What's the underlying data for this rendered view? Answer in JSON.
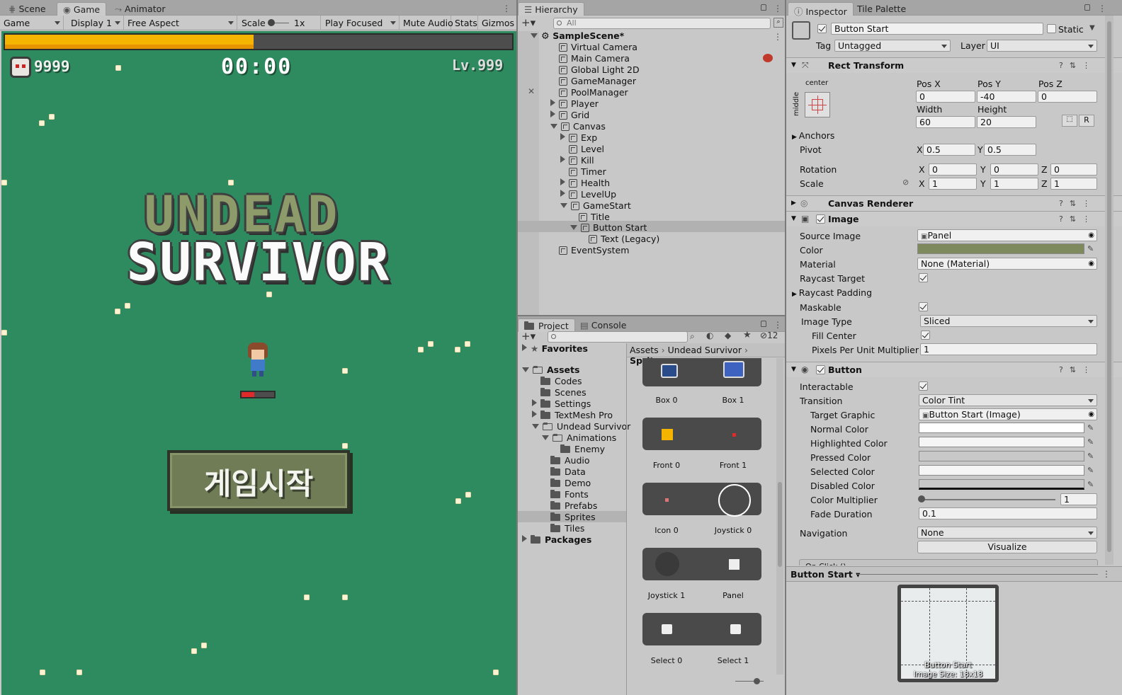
{
  "game_panel": {
    "tabs": [
      "Scene",
      "Game",
      "Animator"
    ],
    "toolbar": {
      "display_mode": "Game",
      "display": "Display 1",
      "aspect": "Free Aspect",
      "scale_label": "Scale",
      "scale_value": "1x",
      "play_mode": "Play Focused",
      "mute": "Mute Audio",
      "stats": "Stats",
      "gizmos": "Gizmos"
    },
    "hud": {
      "kills": "9999",
      "timer": "00:00",
      "level": "Lv.999",
      "exp_fill": 0.49
    },
    "title_line1": "UNDEAD",
    "title_line2": "SURVIVOR",
    "start_button": "게임시작",
    "colors": {
      "grass": "#2e8a5f",
      "exp_bar": "#f5b400",
      "button": "#6f7c55"
    }
  },
  "hierarchy": {
    "tab": "Hierarchy",
    "search_placeholder": "All",
    "scene": "SampleScene*",
    "items": [
      {
        "label": "Virtual Camera"
      },
      {
        "label": "Main Camera"
      },
      {
        "label": "Global Light 2D"
      },
      {
        "label": "GameManager"
      },
      {
        "label": "PoolManager"
      },
      {
        "label": "Player"
      },
      {
        "label": "Grid"
      },
      {
        "label": "Canvas"
      },
      {
        "label": "Exp"
      },
      {
        "label": "Level"
      },
      {
        "label": "Kill"
      },
      {
        "label": "Timer"
      },
      {
        "label": "Health"
      },
      {
        "label": "LevelUp"
      },
      {
        "label": "GameStart"
      },
      {
        "label": "Title"
      },
      {
        "label": "Button Start"
      },
      {
        "label": "Text (Legacy)"
      },
      {
        "label": "EventSystem"
      }
    ]
  },
  "project": {
    "tabs": [
      "Project",
      "Console"
    ],
    "count": "12",
    "breadcrumb": [
      "Assets",
      "Undead Survivor",
      "Sprites"
    ],
    "tree": {
      "favorites": "Favorites",
      "assets": "Assets",
      "codes": "Codes",
      "scenes": "Scenes",
      "settings": "Settings",
      "textmesh": "TextMesh Pro",
      "undead": "Undead Survivor",
      "animations": "Animations",
      "enemy": "Enemy",
      "audio": "Audio",
      "data": "Data",
      "demo": "Demo",
      "fonts": "Fonts",
      "prefabs": "Prefabs",
      "sprites": "Sprites",
      "tiles": "Tiles",
      "packages": "Packages"
    },
    "sprites": [
      [
        "Box 0",
        "Box 1"
      ],
      [
        "Front 0",
        "Front 1"
      ],
      [
        "Icon 0",
        "Joystick 0"
      ],
      [
        "Joystick 1",
        "Panel"
      ],
      [
        "Select 0",
        "Select 1"
      ]
    ]
  },
  "inspector": {
    "tabs": [
      "Inspector",
      "Tile Palette"
    ],
    "object_name": "Button Start",
    "static_label": "Static",
    "tag_label": "Tag",
    "tag_value": "Untagged",
    "layer_label": "Layer",
    "layer_value": "UI",
    "rect": {
      "title": "Rect Transform",
      "anchor_h": "center",
      "anchor_v": "middle",
      "posx_label": "Pos X",
      "posx": "0",
      "posy_label": "Pos Y",
      "posy": "-40",
      "posz_label": "Pos Z",
      "posz": "0",
      "width_label": "Width",
      "width": "60",
      "height_label": "Height",
      "height": "20",
      "r_btn": "R",
      "anchors": "Anchors",
      "pivot": "Pivot",
      "pivot_x": "0.5",
      "pivot_y": "0.5",
      "rotation": "Rotation",
      "rot_x": "0",
      "rot_y": "0",
      "rot_z": "0",
      "scale": "Scale",
      "scale_x": "1",
      "scale_y": "1",
      "scale_z": "1",
      "x": "X",
      "y": "Y",
      "z": "Z"
    },
    "canvas_renderer": "Canvas Renderer",
    "image": {
      "title": "Image",
      "source_image_label": "Source Image",
      "source_image": "Panel",
      "color_label": "Color",
      "color_value": "#7e8a5d",
      "material_label": "Material",
      "material": "None (Material)",
      "raycast_target": "Raycast Target",
      "raycast_padding": "Raycast Padding",
      "maskable": "Maskable",
      "image_type_label": "Image Type",
      "image_type": "Sliced",
      "fill_center": "Fill Center",
      "ppu_label": "Pixels Per Unit Multiplier",
      "ppu": "1"
    },
    "button": {
      "title": "Button",
      "interactable": "Interactable",
      "transition_label": "Transition",
      "transition": "Color Tint",
      "target_graphic_label": "Target Graphic",
      "target_graphic": "Button Start (Image)",
      "normal": "Normal Color",
      "highlighted": "Highlighted Color",
      "pressed": "Pressed Color",
      "selected": "Selected Color",
      "disabled": "Disabled Color",
      "multiplier_label": "Color Multiplier",
      "multiplier": "1",
      "fade_label": "Fade Duration",
      "fade": "0.1",
      "navigation_label": "Navigation",
      "navigation": "None",
      "visualize": "Visualize",
      "onclick": "On Click ()"
    },
    "preview": {
      "title": "Button Start",
      "name": "Button Start",
      "size": "Image Size: 18x18"
    }
  }
}
